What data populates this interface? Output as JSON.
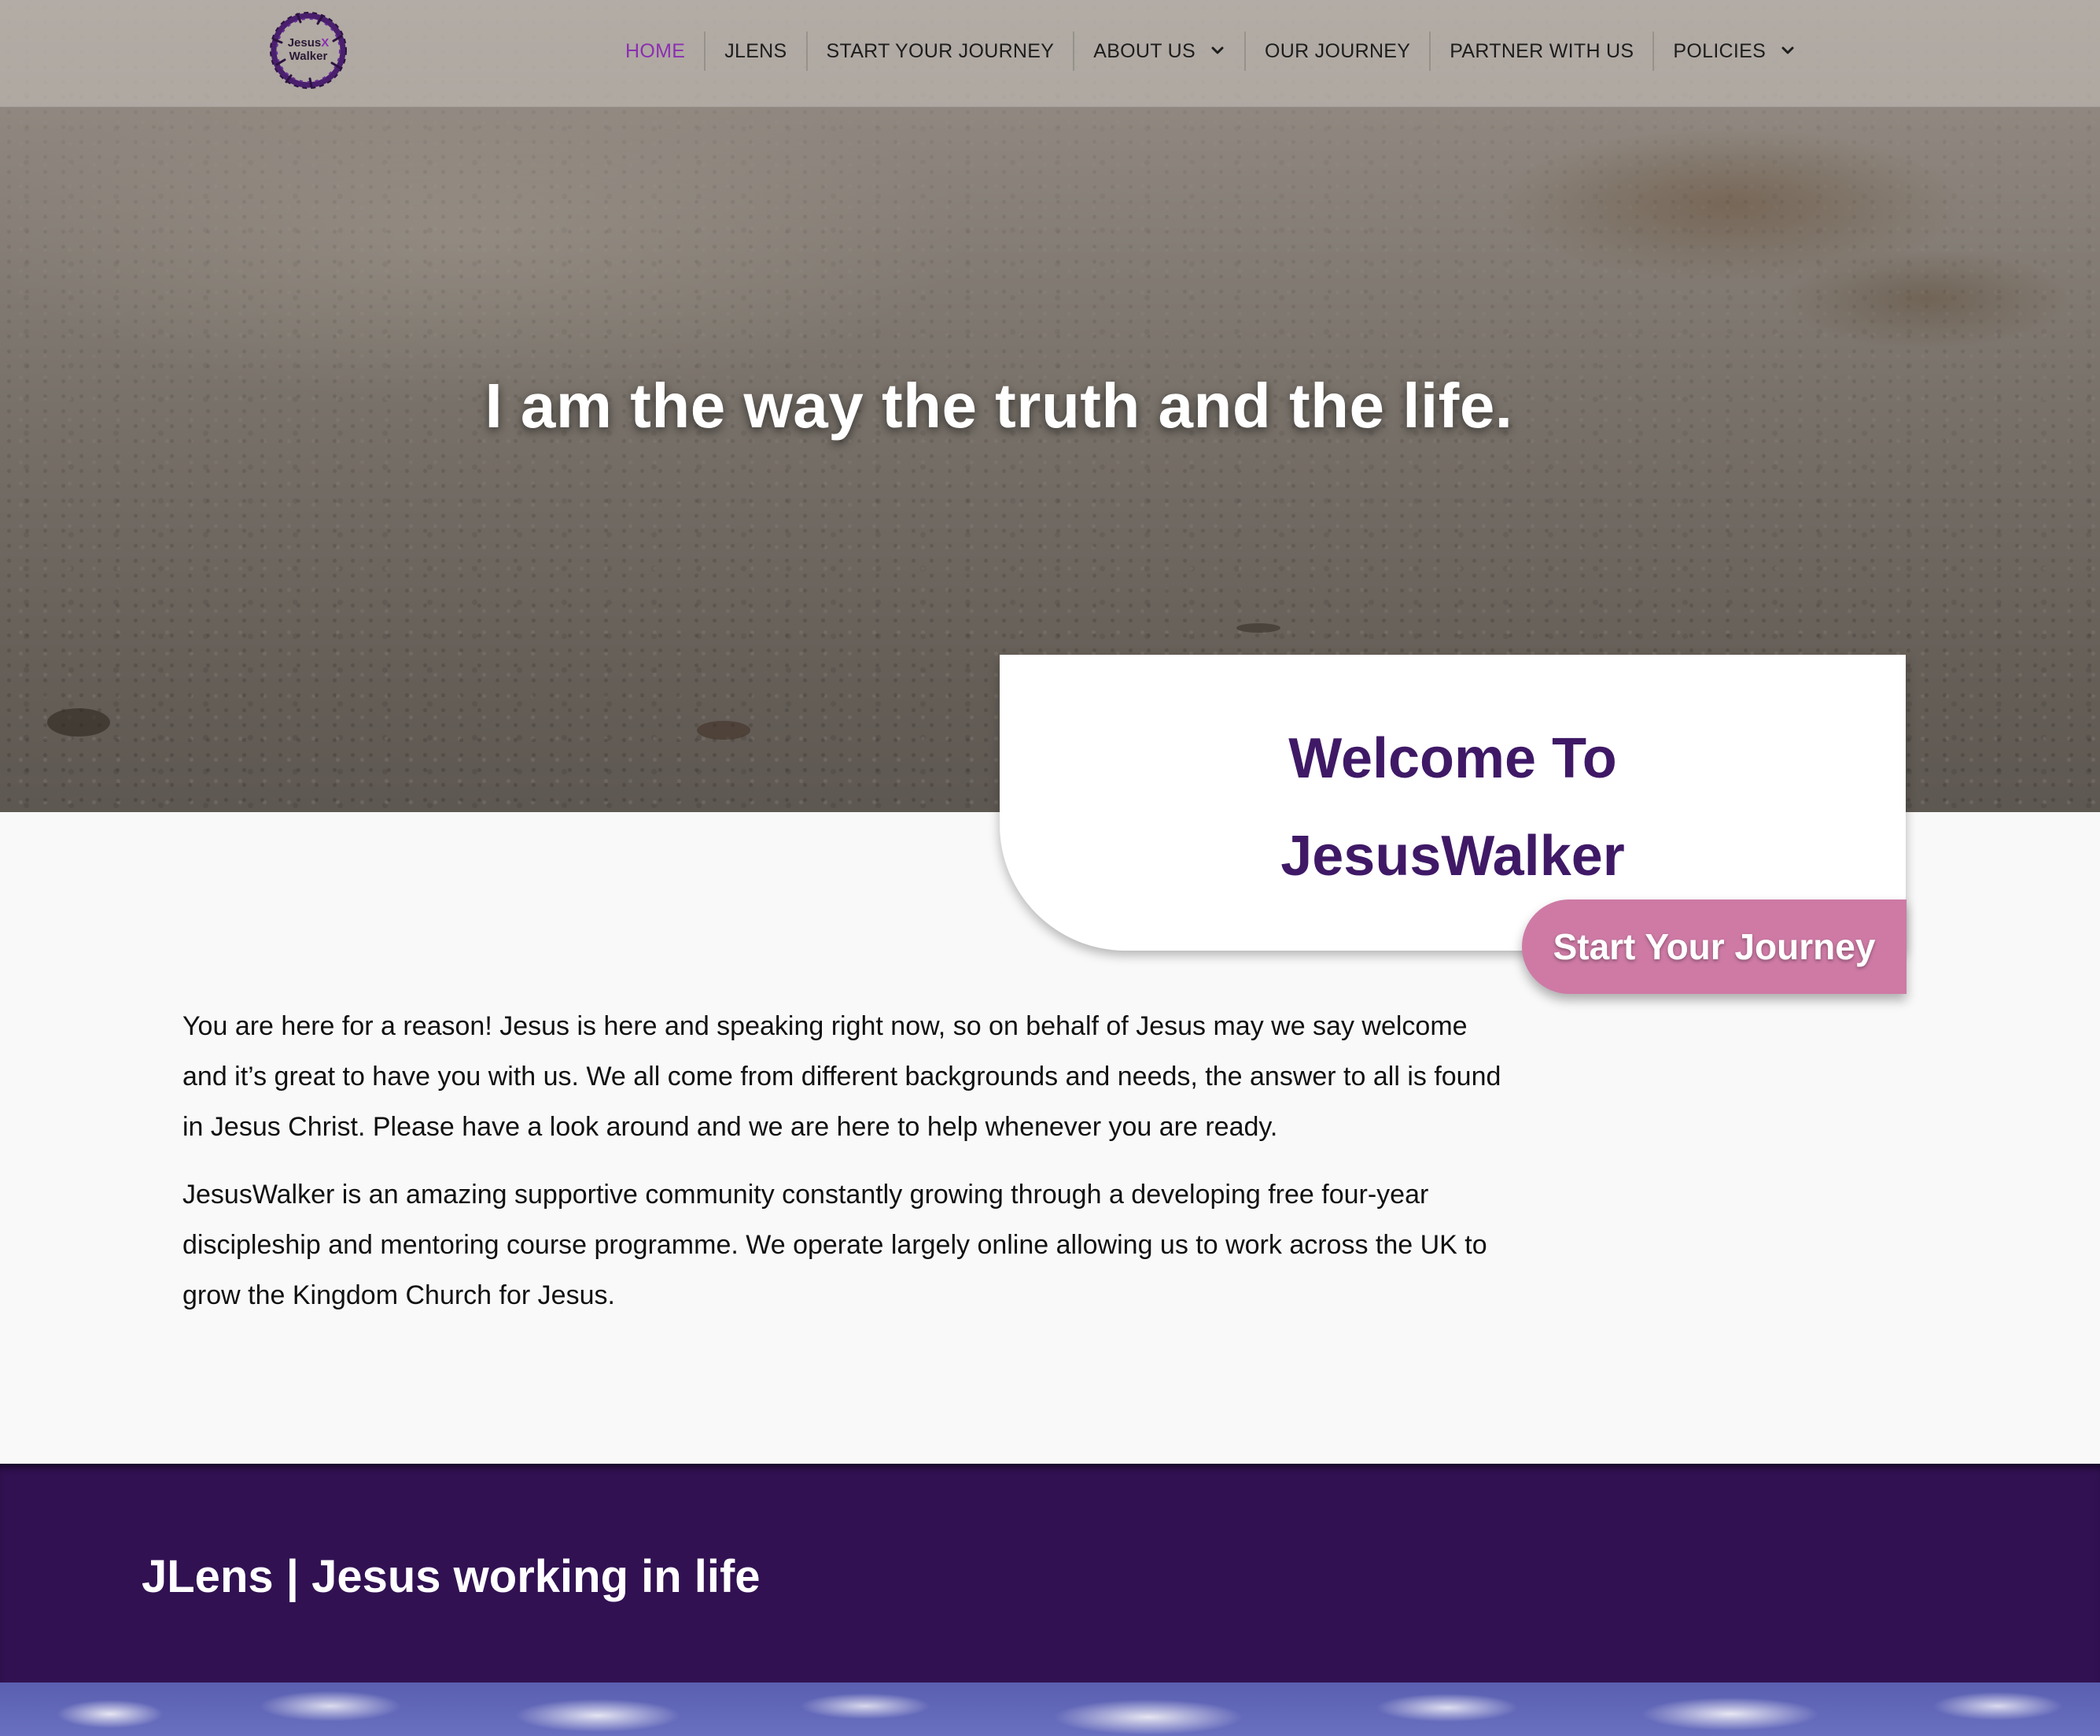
{
  "logo": {
    "line1": "Jesus",
    "mark": "X",
    "line2": "Walker"
  },
  "nav": {
    "items": [
      {
        "label": "HOME"
      },
      {
        "label": "JLENS"
      },
      {
        "label": "START YOUR JOURNEY"
      },
      {
        "label": "ABOUT US"
      },
      {
        "label": "OUR JOURNEY"
      },
      {
        "label": "PARTNER WITH US"
      },
      {
        "label": "POLICIES"
      }
    ]
  },
  "hero": {
    "tagline": "I am the way the truth and the life."
  },
  "welcome": {
    "line1": "Welcome To",
    "line2": "JesusWalker",
    "button_label": "Start Your Journey"
  },
  "intro": {
    "p1": "You are here for a reason! Jesus is here and speaking right now, so on behalf of Jesus may we say welcome and it’s great to have you with us. We all come from different backgrounds and needs, the answer to all is found in Jesus Christ. Please have a look around and we are here to help whenever you are ready.",
    "p2": "JesusWalker is an amazing supportive community constantly growing through a developing free four-year discipleship and mentoring course programme. We operate largely online allowing us to work across the UK to grow the Kingdom Church for Jesus."
  },
  "section": {
    "title": "JLens | Jesus working in life"
  },
  "colors": {
    "brand_purple": "#3f1966",
    "band_purple": "#311152",
    "active_nav": "#8b2fb1",
    "button_pink": "#ce7aa5"
  }
}
